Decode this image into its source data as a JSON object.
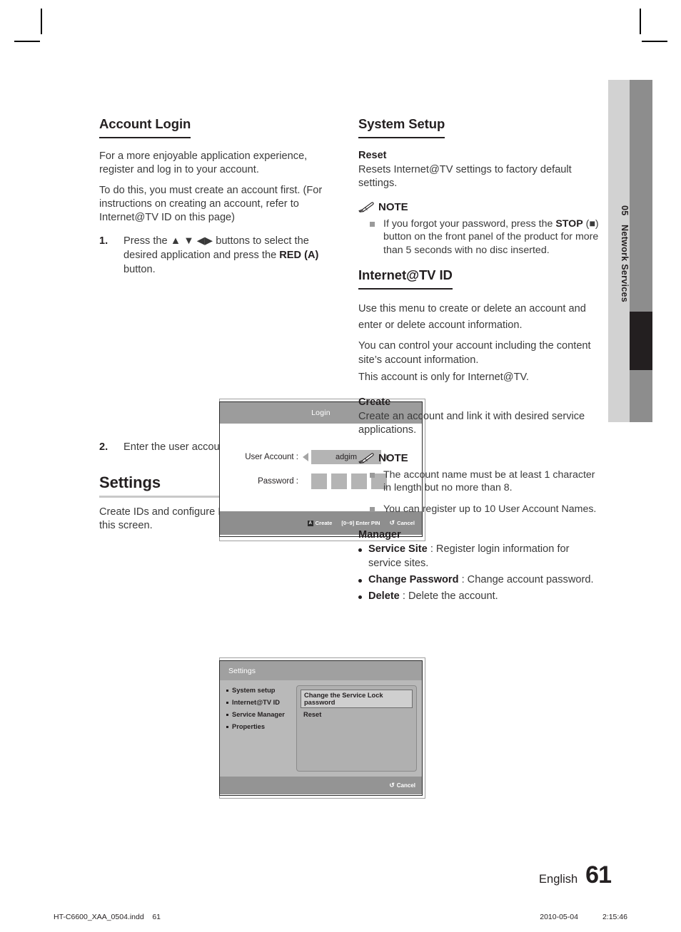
{
  "side_tab": {
    "chapter_number": "05",
    "chapter_title": "Network Services"
  },
  "left_column": {
    "account_login": {
      "heading": "Account Login",
      "paragraphs": [
        "For a more enjoyable application experience, register and log in to your account.",
        "To do this, you must create an account first. (For instructions on creating an account, refer to Internet@TV ID on this page)"
      ],
      "steps": [
        {
          "num": "1.",
          "text_before": "Press the ▲ ▼ ◀▶ buttons to select the desired application and press the ",
          "bold": "RED (A)",
          "text_after": " button."
        },
        {
          "num": "2.",
          "text_before": "Enter the user account and password.",
          "bold": "",
          "text_after": ""
        }
      ]
    },
    "login_screenshot": {
      "title": "Login",
      "user_account_label": "User Account :",
      "user_account_value": "adgim",
      "password_label": "Password :",
      "password_dot_count": 4,
      "footer": {
        "create_key": "A",
        "create_label": "Create",
        "pin_label": "[0~9] Enter PIN",
        "return_glyph": "↺",
        "cancel_label": "Cancel"
      }
    },
    "settings": {
      "heading": "Settings",
      "paragraph": "Create IDs and configure Internet@TV settings on this screen."
    },
    "settings_screenshot": {
      "title": "Settings",
      "menu_items": [
        "System setup",
        "Internet@TV ID",
        "Service Manager",
        "Properties"
      ],
      "panel_rows": [
        {
          "label": "Change the Service Lock password",
          "selected": true
        },
        {
          "label": "Reset",
          "selected": false
        }
      ],
      "footer": {
        "return_glyph": "↺",
        "cancel_label": "Cancel"
      }
    }
  },
  "right_column": {
    "system_setup": {
      "heading": "System Setup",
      "reset": {
        "sub_heading": "Reset",
        "text": "Resets Internet@TV settings to factory default settings."
      },
      "note": {
        "title": "NOTE",
        "items": [
          {
            "text_1": "If you forgot your password, press the ",
            "bold": "STOP",
            "text_2": " (■) button on the front panel of the product for more than 5 seconds with no disc inserted."
          }
        ]
      }
    },
    "internet_tv_id": {
      "heading": "Internet@TV ID",
      "paragraphs": [
        "Use this menu to create or delete an account and enter or delete account information.",
        "You can control your account including the content site’s account information.",
        "This account is only for Internet@TV."
      ],
      "create": {
        "sub_heading": "Create",
        "text": "Create an account and link it with desired service applications."
      },
      "note": {
        "title": "NOTE",
        "items": [
          {
            "text_1": "The account name must be at least 1 character in length but no more than 8.",
            "bold": "",
            "text_2": ""
          },
          {
            "text_1": "You can register up to 10 User Account Names.",
            "bold": "",
            "text_2": ""
          }
        ]
      },
      "manager": {
        "sub_heading": "Manager",
        "bullets": [
          {
            "bold": "Service Site",
            "text": " : Register login information for service sites."
          },
          {
            "bold": "Change Password",
            "text": " : Change account password."
          },
          {
            "bold": "Delete",
            "text": " : Delete the account."
          }
        ]
      }
    }
  },
  "page_footer": {
    "language": "English",
    "page_number": "61"
  },
  "print_footer": {
    "filename": "HT-C6600_XAA_0504.indd",
    "folio": "61",
    "date": "2010-05-04",
    "time": "2:15:46"
  }
}
